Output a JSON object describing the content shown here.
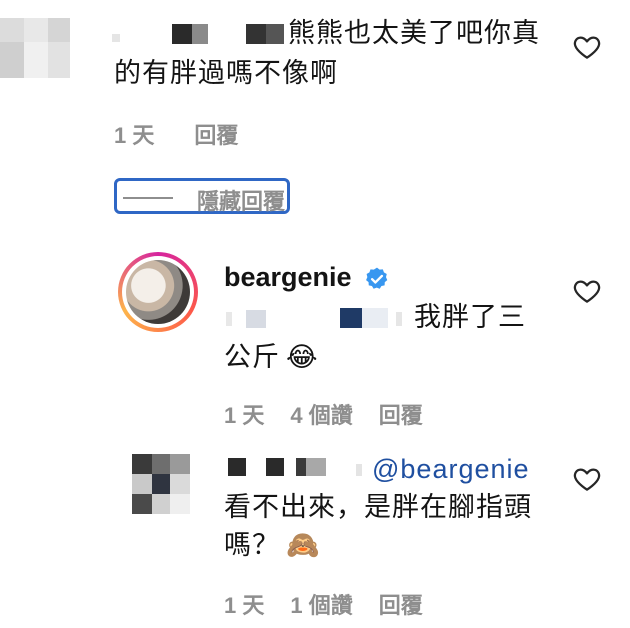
{
  "comment1": {
    "text_line1": "熊熊也太美了吧你真",
    "text_line2": "的有胖過嗎不像啊",
    "time": "1 天",
    "reply": "回覆",
    "heart_icon": "heart-outline-icon"
  },
  "hide_replies": {
    "label": "隱藏回覆"
  },
  "reply1": {
    "username": "beargenie",
    "verified_icon": "verified-badge-icon",
    "text_line1": "我胖了三",
    "text_line2": "公斤",
    "emoji": "😂",
    "time": "1 天",
    "likes": "4 個讚",
    "reply": "回覆",
    "heart_icon": "heart-outline-icon"
  },
  "reply2": {
    "mention": "@beargenie",
    "text_line1": "看不出來，是胖在腳指頭",
    "text_line2": "嗎？",
    "emoji": "🙈",
    "time": "1 天",
    "likes": "1 個讚",
    "reply": "回覆",
    "heart_icon": "heart-outline-icon"
  },
  "colors": {
    "accent": "#2f67c5",
    "verified": "#3897f0",
    "muted": "#8e8e8e",
    "mention": "#1f4fa0"
  }
}
